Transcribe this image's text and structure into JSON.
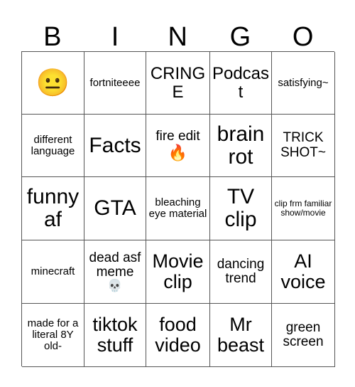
{
  "card": {
    "title": "BINGO",
    "header_letters": [
      "B",
      "I",
      "N",
      "G",
      "O"
    ],
    "grid_line_color": "#555555",
    "background_color": "#ffffff",
    "text_color": "#000000",
    "rows": 5,
    "columns": 5,
    "cells": [
      {
        "text": "",
        "emoji": "😐",
        "emoji_name": "neutral-face-emoji",
        "size": "emoji",
        "layout": "emoji-only"
      },
      {
        "text": "fortniteeee",
        "emoji": "",
        "emoji_name": "",
        "size": "sz-sm",
        "layout": "text-only"
      },
      {
        "text": "CRINGE",
        "emoji": "",
        "emoji_name": "",
        "size": "sz-lg",
        "layout": "text-only"
      },
      {
        "text": "Podcast",
        "emoji": "",
        "emoji_name": "",
        "size": "sz-lg",
        "layout": "text-only"
      },
      {
        "text": "satisfying~",
        "emoji": "",
        "emoji_name": "",
        "size": "sz-sm",
        "layout": "text-only"
      },
      {
        "text": "different language",
        "emoji": "",
        "emoji_name": "",
        "size": "sz-sm",
        "layout": "text-only"
      },
      {
        "text": "Facts",
        "emoji": "",
        "emoji_name": "",
        "size": "sz-xxl",
        "layout": "text-only"
      },
      {
        "text": "fire edit",
        "emoji": "🔥",
        "emoji_name": "fire-emoji",
        "size": "sz-md",
        "layout": "text-with-inline-emoji"
      },
      {
        "text": "brain rot",
        "emoji": "",
        "emoji_name": "",
        "size": "sz-xxl",
        "layout": "text-only"
      },
      {
        "text": "TRICK SHOT~",
        "emoji": "",
        "emoji_name": "",
        "size": "sz-md",
        "layout": "text-only"
      },
      {
        "text": "funny af",
        "emoji": "",
        "emoji_name": "",
        "size": "sz-xxl",
        "layout": "text-only"
      },
      {
        "text": "GTA",
        "emoji": "",
        "emoji_name": "",
        "size": "sz-xxl",
        "layout": "text-only"
      },
      {
        "text": "bleaching eye material",
        "emoji": "",
        "emoji_name": "",
        "size": "sz-sm",
        "layout": "text-only"
      },
      {
        "text": "TV clip",
        "emoji": "",
        "emoji_name": "",
        "size": "sz-xxl",
        "layout": "text-only"
      },
      {
        "text": "clip frm familiar show/movie",
        "emoji": "",
        "emoji_name": "",
        "size": "sz-xxs",
        "layout": "text-only"
      },
      {
        "text": "minecraft",
        "emoji": "",
        "emoji_name": "",
        "size": "sz-sm",
        "layout": "text-only"
      },
      {
        "text": "dead asf meme",
        "emoji": "💀",
        "emoji_name": "skull-emoji",
        "size": "sz-md",
        "layout": "text-with-block-emoji"
      },
      {
        "text": "Movie clip",
        "emoji": "",
        "emoji_name": "",
        "size": "sz-xl",
        "layout": "text-only"
      },
      {
        "text": "dancing trend",
        "emoji": "",
        "emoji_name": "",
        "size": "sz-md",
        "layout": "text-only"
      },
      {
        "text": "AI voice",
        "emoji": "",
        "emoji_name": "",
        "size": "sz-xl",
        "layout": "text-only"
      },
      {
        "text": "made for a literal 8Y old-",
        "emoji": "",
        "emoji_name": "",
        "size": "sz-sm",
        "layout": "text-only"
      },
      {
        "text": "tiktok stuff",
        "emoji": "",
        "emoji_name": "",
        "size": "sz-xl",
        "layout": "text-only"
      },
      {
        "text": "food video",
        "emoji": "",
        "emoji_name": "",
        "size": "sz-xl",
        "layout": "text-only"
      },
      {
        "text": "Mr beast",
        "emoji": "",
        "emoji_name": "",
        "size": "sz-xl",
        "layout": "text-only"
      },
      {
        "text": "green screen",
        "emoji": "",
        "emoji_name": "",
        "size": "sz-md",
        "layout": "text-only"
      }
    ]
  }
}
